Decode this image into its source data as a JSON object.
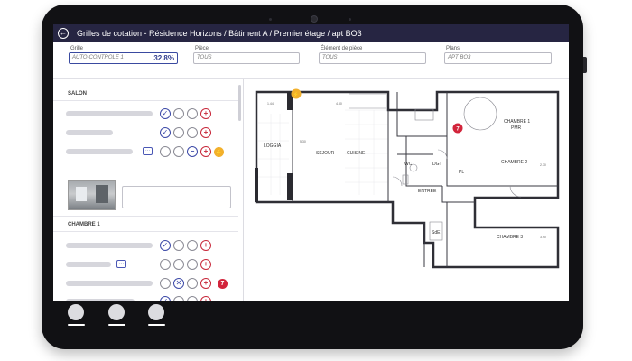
{
  "header": {
    "title": "Grilles de cotation - Résidence Horizons / Bâtiment A / Premier étage / apt BO3"
  },
  "filters": {
    "grille": {
      "label": "Grille",
      "value": "AUTO-CONTROLE 1",
      "percent": "32.8%"
    },
    "piece": {
      "label": "Pièce",
      "value": "TOUS"
    },
    "element": {
      "label": "Élément de pièce",
      "value": "TOUS"
    },
    "plans": {
      "label": "Plans",
      "value": "APT BO3"
    }
  },
  "sections": {
    "salon": "SALON",
    "chambre1": "CHAMBRE 1"
  },
  "icons": {
    "chat": "chat-icon",
    "check": "check-icon",
    "cross": "cross-icon",
    "plus": "plus-icon",
    "minus": "minus-icon"
  },
  "badges": {
    "warn_symbol": "⚡",
    "alert_number": "7"
  },
  "plan": {
    "rooms": {
      "loggia": "LOGGIA",
      "sejour": "SEJOUR",
      "cuisine": "CUISINE",
      "chambre1": "CHAMBRE 1",
      "pmr": "PMR",
      "chambre2": "CHAMBRE 2",
      "chambre3": "CHAMBRE 3",
      "entree": "ENTREE",
      "wc": "WC",
      "sde": "SdE",
      "degt": "DGT",
      "pl": "PL"
    },
    "dims": {
      "d1": "4.80",
      "d2": "5.30",
      "d3": "1.44",
      "d4": "2.70",
      "d5": "3.90"
    },
    "pins": {
      "warn": "⚡",
      "alert": "7"
    }
  },
  "colors": {
    "header_bg": "#262542",
    "accent": "#3d4aa8",
    "danger": "#c8283a",
    "warning": "#f2b02c"
  }
}
